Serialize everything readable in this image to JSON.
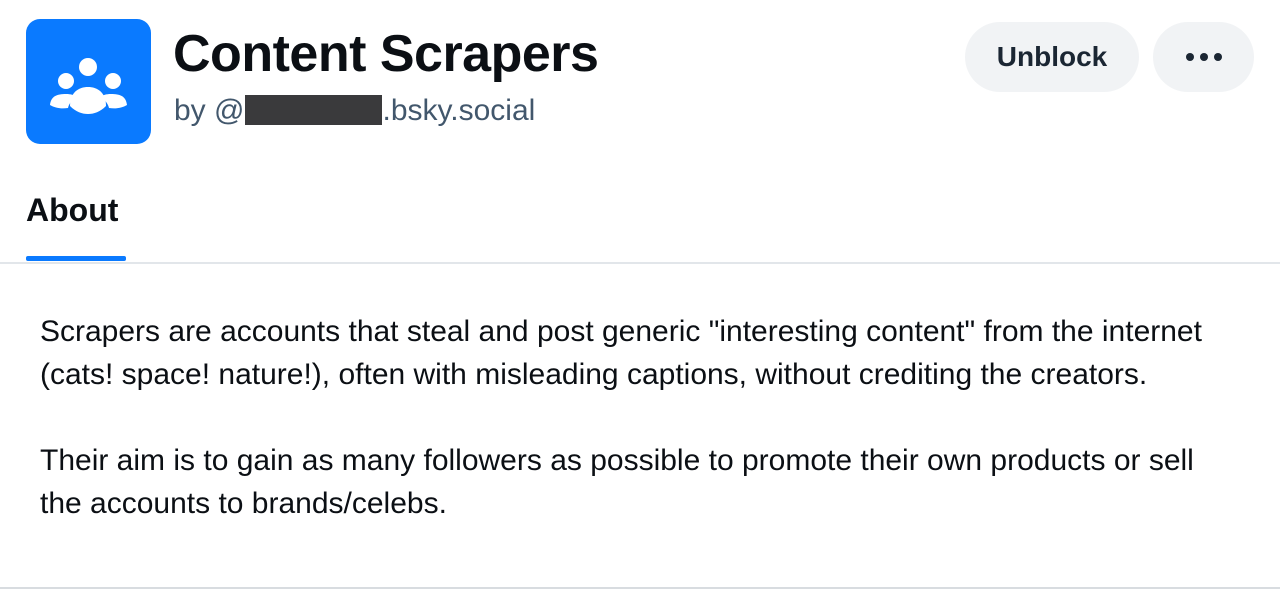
{
  "list": {
    "title": "Content Scrapers",
    "byline_prefix": "by @",
    "byline_suffix": ".bsky.social",
    "avatar_icon": "people-group-icon",
    "avatar_color": "#0a7aff"
  },
  "actions": {
    "unblock_label": "Unblock",
    "more_icon": "more-horizontal-icon"
  },
  "tabs": [
    {
      "label": "About",
      "active": true
    }
  ],
  "accent_color": "#0a7aff",
  "description": {
    "paragraphs": [
      "Scrapers are accounts that steal and post generic \"interesting content\" from the internet (cats! space! nature!), often with misleading captions, without crediting the creators.",
      "Their aim is to gain as many followers as possible to promote their own products or sell the accounts to brands/celebs."
    ]
  }
}
